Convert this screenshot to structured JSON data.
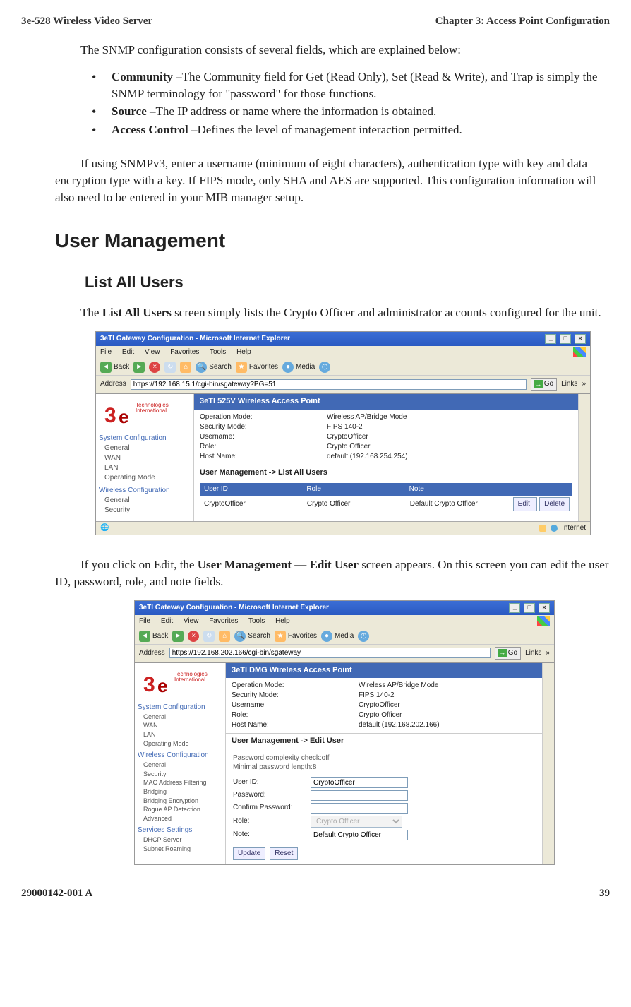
{
  "header": {
    "left": "3e-528 Wireless Video Server",
    "right": "Chapter 3: Access Point Configuration"
  },
  "intro": "The SNMP configuration consists of several fields, which are explained below:",
  "bullets": [
    {
      "term": "Community",
      "text": " –The Community field for Get (Read Only), Set (Read & Write), and Trap is simply the SNMP terminology for \"password\" for those functions."
    },
    {
      "term": "Source",
      "text": " –The IP address or name where the information is obtained."
    },
    {
      "term": "Access Control",
      "text": " –Defines the level of management interaction permitted."
    }
  ],
  "para_snmp": "If using SNMPv3, enter a username (minimum of eight characters), authentication type with key and data encryption type with a key. If FIPS mode, only SHA and AES are supported. This configuration information will also need to be entered in your MIB manager setup.",
  "h1": "User Management",
  "h2": "List All Users",
  "para_list_pre": "The ",
  "para_list_bold": "List All Users",
  "para_list_post": " screen simply lists the Crypto Officer and administrator accounts configured for the unit.",
  "para_edit_pre": "If you click on Edit, the ",
  "para_edit_bold": "User Management — Edit User",
  "para_edit_post": " screen appears. On this screen you can edit the user ID, password, role, and note fields.",
  "footer": {
    "left": "29000142-001 A",
    "right": "39"
  },
  "ss1": {
    "title": "3eTI Gateway Configuration - Microsoft Internet Explorer",
    "menus": [
      "File",
      "Edit",
      "View",
      "Favorites",
      "Tools",
      "Help"
    ],
    "back": "Back",
    "search": "Search",
    "favorites": "Favorites",
    "media": "Media",
    "addr_label": "Address",
    "addr": "https://192.168.15.1/cgi-bin/sgateway?PG=51",
    "go": "Go",
    "links": "Links",
    "banner": "3eTI 525V Wireless Access Point",
    "logo_tag1": "Technologies",
    "logo_tag2": "International",
    "info": [
      [
        "Operation Mode:",
        "Wireless AP/Bridge Mode"
      ],
      [
        "Security Mode:",
        "FIPS 140-2"
      ],
      [
        "Username:",
        "CryptoOfficer"
      ],
      [
        "Role:",
        "Crypto Officer"
      ],
      [
        "Host Name:",
        "default (192.168.254.254)"
      ]
    ],
    "section": "User Management -> List All Users",
    "cols": [
      "User ID",
      "Role",
      "Note"
    ],
    "row": [
      "CryptoOfficer",
      "Crypto Officer",
      "Default Crypto Officer"
    ],
    "edit": "Edit",
    "delete": "Delete",
    "side": {
      "cat1": "System Configuration",
      "items1": [
        "General",
        "WAN",
        "LAN",
        "Operating Mode"
      ],
      "cat2": "Wireless Configuration",
      "items2": [
        "General",
        "Security"
      ]
    },
    "status": "Internet"
  },
  "ss2": {
    "title": "3eTI Gateway Configuration - Microsoft Internet Explorer",
    "menus": [
      "File",
      "Edit",
      "View",
      "Favorites",
      "Tools",
      "Help"
    ],
    "back": "Back",
    "search": "Search",
    "favorites": "Favorites",
    "media": "Media",
    "addr_label": "Address",
    "addr": "https://192.168.202.166/cgi-bin/sgateway",
    "go": "Go",
    "links": "Links",
    "banner": "3eTI DMG Wireless Access Point",
    "info": [
      [
        "Operation Mode:",
        "Wireless AP/Bridge Mode"
      ],
      [
        "Security Mode:",
        "FIPS 140-2"
      ],
      [
        "Username:",
        "CryptoOfficer"
      ],
      [
        "Role:",
        "Crypto Officer"
      ],
      [
        "Host Name:",
        "default (192.168.202.166)"
      ]
    ],
    "section": "User Management -> Edit User",
    "note1": "Password complexity check:off",
    "note2": "Minimal password length:8",
    "fields": {
      "userid_l": "User ID:",
      "userid_v": "CryptoOfficer",
      "pw_l": "Password:",
      "cpw_l": "Confirm Password:",
      "role_l": "Role:",
      "role_v": "Crypto Officer",
      "note_l": "Note:",
      "note_v": "Default Crypto Officer"
    },
    "update": "Update",
    "reset": "Reset",
    "side": {
      "cat1": "System Configuration",
      "items1": [
        "General",
        "WAN",
        "LAN",
        "Operating Mode"
      ],
      "cat2": "Wireless Configuration",
      "items2": [
        "General",
        "Security",
        "MAC Address Filtering",
        "Bridging",
        "Bridging Encryption",
        "Rogue AP Detection",
        "Advanced"
      ],
      "cat3": "Services Settings",
      "items3": [
        "DHCP Server",
        "Subnet Roaming"
      ]
    }
  }
}
